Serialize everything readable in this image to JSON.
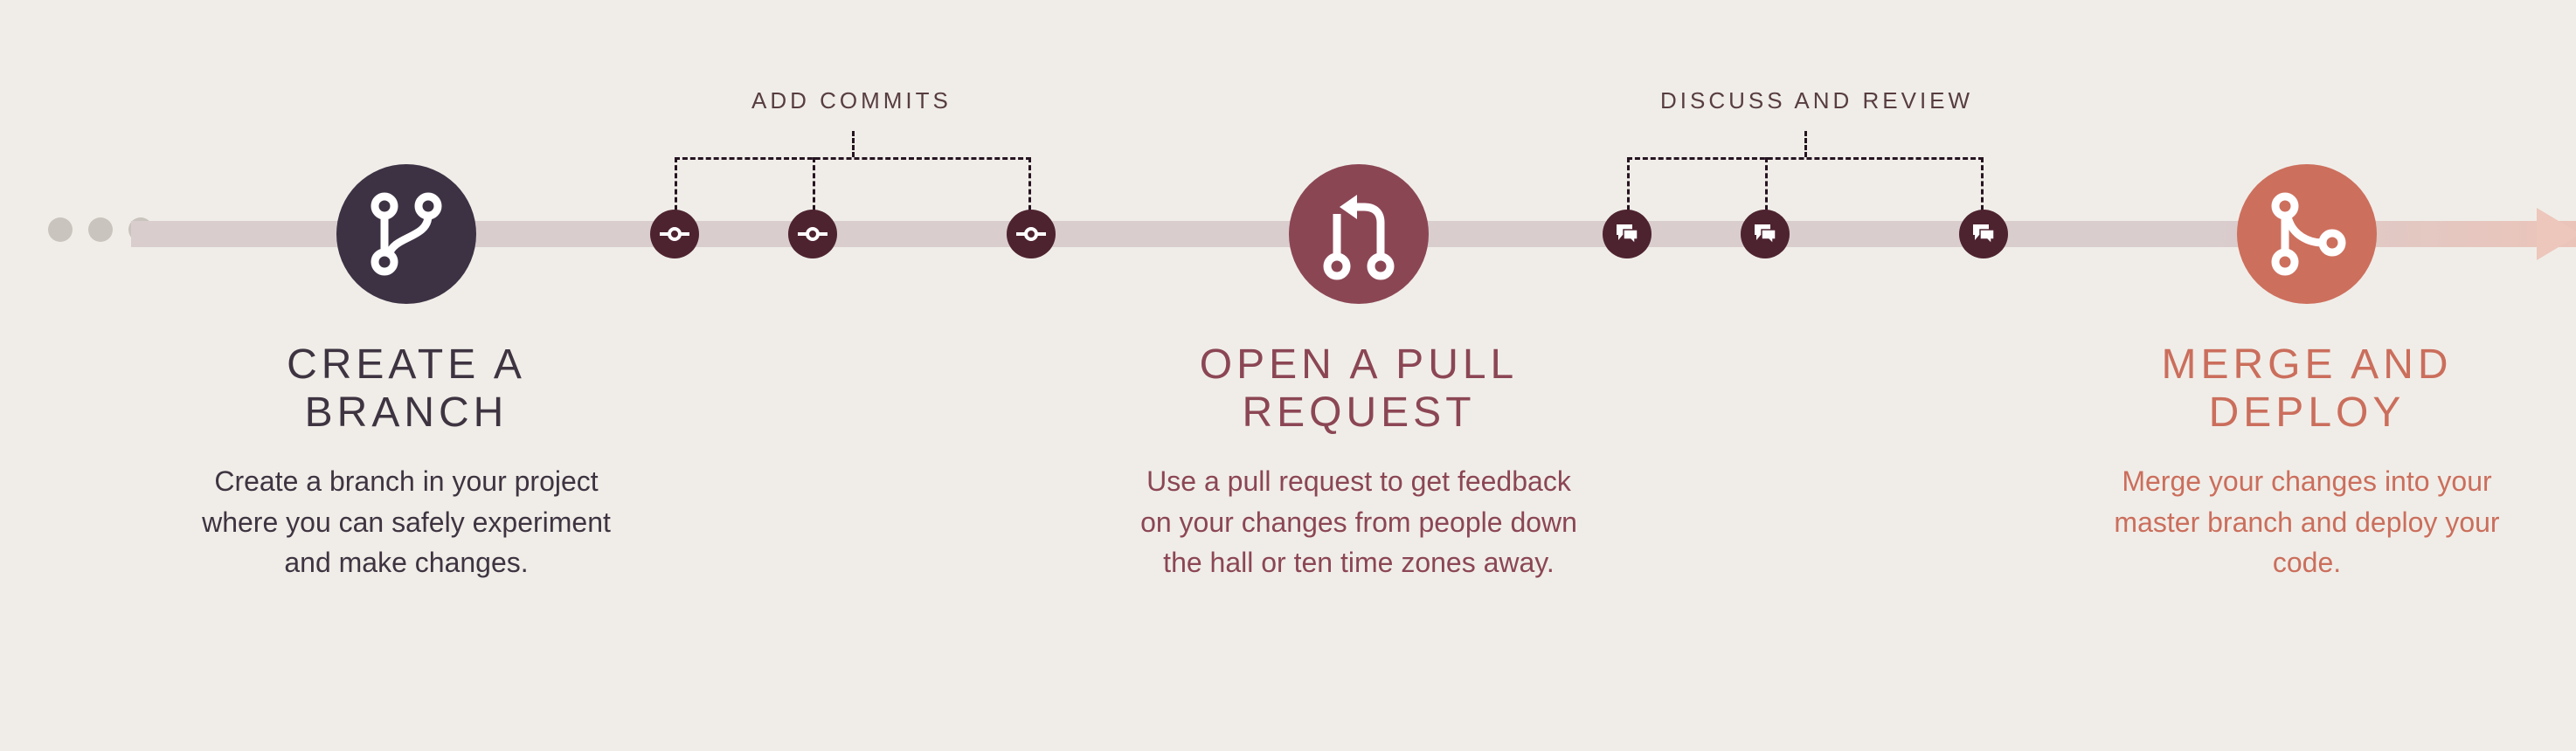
{
  "labels": {
    "commits": "ADD COMMITS",
    "discuss": "DISCUSS AND REVIEW"
  },
  "columns": {
    "branch": {
      "title": "CREATE A BRANCH",
      "body": "Create a branch in your project where you can safely experiment and make changes."
    },
    "pr": {
      "title": "OPEN A PULL REQUEST",
      "body": "Use a pull request to get feedback on your changes from people down the hall or ten time zones away."
    },
    "merge": {
      "title": "MERGE AND DEPLOY",
      "body": "Merge your changes into your master branch and deploy your code."
    }
  }
}
